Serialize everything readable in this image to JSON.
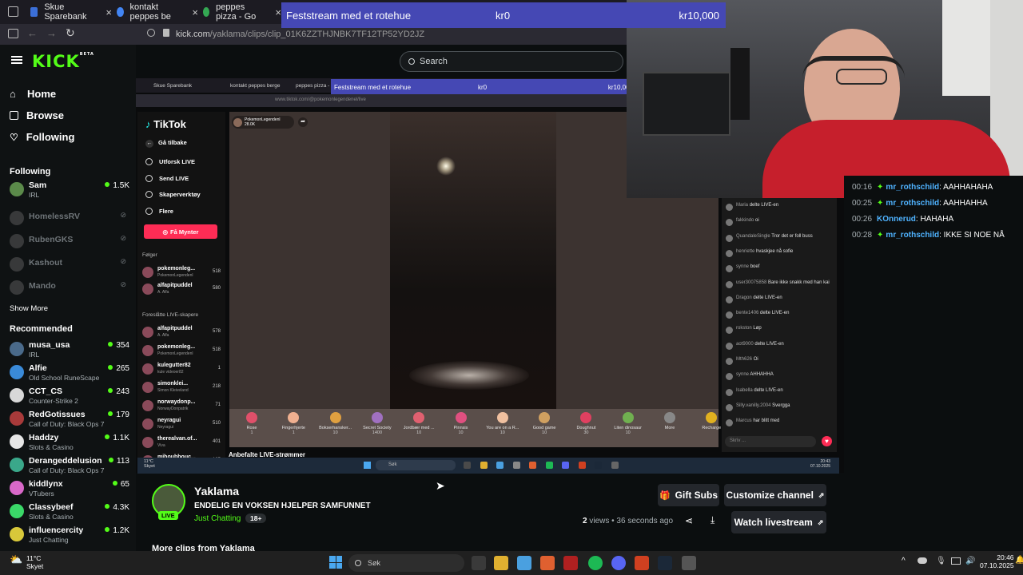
{
  "browser": {
    "tabs": [
      {
        "title": "Skue Sparebank",
        "color": "#3b6fd8"
      },
      {
        "title": "kontakt peppes be",
        "color": "#4285f4"
      },
      {
        "title": "peppes pizza - Go",
        "color": "#34a853"
      }
    ],
    "url_domain": "kick.com",
    "url_path": "/yaklama/clips/clip_01K6ZZTHJNBK7TF12TP52YD2JZ"
  },
  "donation_bar": {
    "label": "Feststream med et rotehue",
    "current": "kr0",
    "goal": "kr10,000"
  },
  "kick": {
    "logo": "KICK",
    "logo_beta": "BETA",
    "search_placeholder": "Search",
    "nav": [
      {
        "label": "Home",
        "icon": "home-icon"
      },
      {
        "label": "Browse",
        "icon": "browse-icon"
      },
      {
        "label": "Following",
        "icon": "heart-icon"
      }
    ],
    "following_heading": "Following",
    "following": [
      {
        "name": "Sam",
        "sub": "IRL",
        "viewers": "1.5K",
        "online": true,
        "color": "#5b8a4a"
      },
      {
        "name": "HomelessRV",
        "online": false,
        "color": "#6a6a6a"
      },
      {
        "name": "RubenGKS",
        "online": false,
        "color": "#6a6a6a"
      },
      {
        "name": "Kashout",
        "online": false,
        "color": "#6a6a6a"
      },
      {
        "name": "Mando",
        "online": false,
        "color": "#6a6a6a"
      }
    ],
    "show_more": "Show More",
    "recommended_heading": "Recommended",
    "recommended": [
      {
        "name": "musa_usa",
        "sub": "IRL",
        "viewers": "354",
        "color": "#4a6a8a"
      },
      {
        "name": "Alfie",
        "sub": "Old School RuneScape",
        "viewers": "265",
        "color": "#3a8ad8"
      },
      {
        "name": "CCT_CS",
        "sub": "Counter-Strike 2",
        "viewers": "243",
        "color": "#d8d8d8"
      },
      {
        "name": "RedGotissues",
        "sub": "Call of Duty: Black Ops 7",
        "viewers": "179",
        "color": "#a83a3a"
      },
      {
        "name": "Haddzy",
        "sub": "Slots & Casino",
        "viewers": "1.1K",
        "color": "#e6e6e6"
      },
      {
        "name": "Derangeddelusion",
        "sub": "Call of Duty: Black Ops 7",
        "viewers": "113",
        "color": "#3aa88a"
      },
      {
        "name": "kiddlynx",
        "sub": "VTubers",
        "viewers": "65",
        "color": "#d868c8"
      },
      {
        "name": "Classybeef",
        "sub": "Slots & Casino",
        "viewers": "4.3K",
        "color": "#3ad868"
      },
      {
        "name": "influencercity",
        "sub": "Just Chatting",
        "viewers": "1.2K",
        "color": "#d8c83a"
      }
    ],
    "channel": {
      "name": "Yaklama",
      "live_badge": "LIVE",
      "title": "ENDELIG EN VOKSEN HJELPER SAMFUNNET",
      "category": "Just Chatting",
      "age": "18+",
      "views": "2",
      "views_label": "views",
      "time_ago": "36 seconds ago",
      "more_clips": "More clips from Yaklama"
    },
    "buttons": {
      "gift_subs": "Gift Subs",
      "customize": "Customize channel",
      "watch": "Watch livestream"
    },
    "chat": [
      {
        "time": "00:16",
        "user": "mr_rothschild",
        "msg": ": AAHHAHAHA",
        "badge": true,
        "green": false
      },
      {
        "time": "00:25",
        "user": "mr_rothschild",
        "msg": ": AAHHAHHA",
        "badge": true,
        "green": false
      },
      {
        "time": "00:26",
        "user": "KOnnerud",
        "msg": ": HAHAHA",
        "badge": false,
        "green": false
      },
      {
        "time": "00:28",
        "user": "mr_rothschild",
        "msg": ": IKKE SI NOE NÅ",
        "badge": true,
        "green": false
      }
    ]
  },
  "clip_inner": {
    "tabs": [
      "Skue Sparebank",
      "kontakt peppes berge",
      "peppes pizza - Go"
    ],
    "url": "www.tiktok.com/@pokemonlegendenel/live",
    "donation": {
      "label": "Feststream med et rotehue",
      "current": "kr0",
      "goal": "kr10,000"
    },
    "tiktok": {
      "logo": "TikTok",
      "back": "Gå tilbake",
      "menu": [
        "Utforsk LIVE",
        "Send LIVE",
        "Skaperverktøy",
        "Flere"
      ],
      "coins_button": "Få Mynter",
      "following_label": "Følger",
      "following": [
        {
          "name": "pokemonleg...",
          "sub": "PokemonLegendenl",
          "count": "518"
        },
        {
          "name": "alfapitpuddel",
          "sub": "A. Alfa",
          "count": "580"
        }
      ],
      "suggested_label": "Foreslåtte LIVE-skapere",
      "suggested": [
        {
          "name": "alfapitpuddel",
          "sub": "A. Alfa",
          "count": "578"
        },
        {
          "name": "pokemonleg...",
          "sub": "PokemonLegendenl",
          "count": "518"
        },
        {
          "name": "kulegutter82",
          "sub": "kule videoer82",
          "count": "1"
        },
        {
          "name": "simonklei...",
          "sub": "Simon Kleiveland",
          "count": "218"
        },
        {
          "name": "norwaydonp...",
          "sub": "NorwayDonpatrik",
          "count": "71"
        },
        {
          "name": "neyragui",
          "sub": "Neyragui",
          "count": "510"
        },
        {
          "name": "therealvan.of...",
          "sub": "Viva",
          "count": "401"
        },
        {
          "name": "mihoubbouc...",
          "sub": "",
          "count": "125"
        }
      ],
      "recommended_label": "Anbefalte LIVE-strømmer",
      "streamer": "PokemonLegendenl",
      "streamer_likes": "28.0K",
      "gifts": [
        "Rose",
        "Fingerhjerte",
        "Bokserhansker...",
        "Secret Society",
        "Jordbær med ...",
        "Pinnsis",
        "You are on a R...",
        "Good game",
        "Doughnut",
        "Liten dinosaur",
        "More",
        "Recharge"
      ],
      "gift_prices": [
        "1",
        "1",
        "10",
        "1400",
        "10",
        "10",
        "10",
        "10",
        "30",
        "10",
        "",
        ""
      ],
      "chat": [
        {
          "user": "Maria",
          "msg": "delte LIVE-en"
        },
        {
          "user": "fakkindo",
          "msg": "oi"
        },
        {
          "user": "QuandaleSingle",
          "msg": "Tror det er foll buss"
        },
        {
          "user": "henriette",
          "msg": "hvaskjee nå sofie"
        },
        {
          "user": "synne",
          "msg": "boef"
        },
        {
          "user": "user30075858",
          "msg": "Bare ikke snakk med han kai"
        },
        {
          "user": "Dragon",
          "msg": "delte LIVE-en"
        },
        {
          "user": "bente1406",
          "msg": "delte LIVE-en"
        },
        {
          "user": "rokston",
          "msg": "Løp"
        },
        {
          "user": "aot9000",
          "msg": "delte LIVE-en"
        },
        {
          "user": "Mth626",
          "msg": "Oi"
        },
        {
          "user": "synne",
          "msg": "AHHAHHA"
        },
        {
          "user": "Isabella",
          "msg": "delte LIVE-en"
        },
        {
          "user": "Silly.vanilly.2004",
          "msg": "Svergga"
        },
        {
          "user": "Marcus",
          "msg": "har blitt med"
        }
      ],
      "chat_placeholder": "Skriv ..."
    },
    "taskbar_weather": "11°C",
    "taskbar_weather_sub": "Skyet",
    "taskbar_search": "Søk",
    "taskbar_time": "20:43",
    "taskbar_date": "07.10.2025"
  },
  "taskbar": {
    "weather_temp": "11°C",
    "weather_desc": "Skyet",
    "search": "Søk",
    "time": "20:46",
    "date": "07.10.2025"
  }
}
